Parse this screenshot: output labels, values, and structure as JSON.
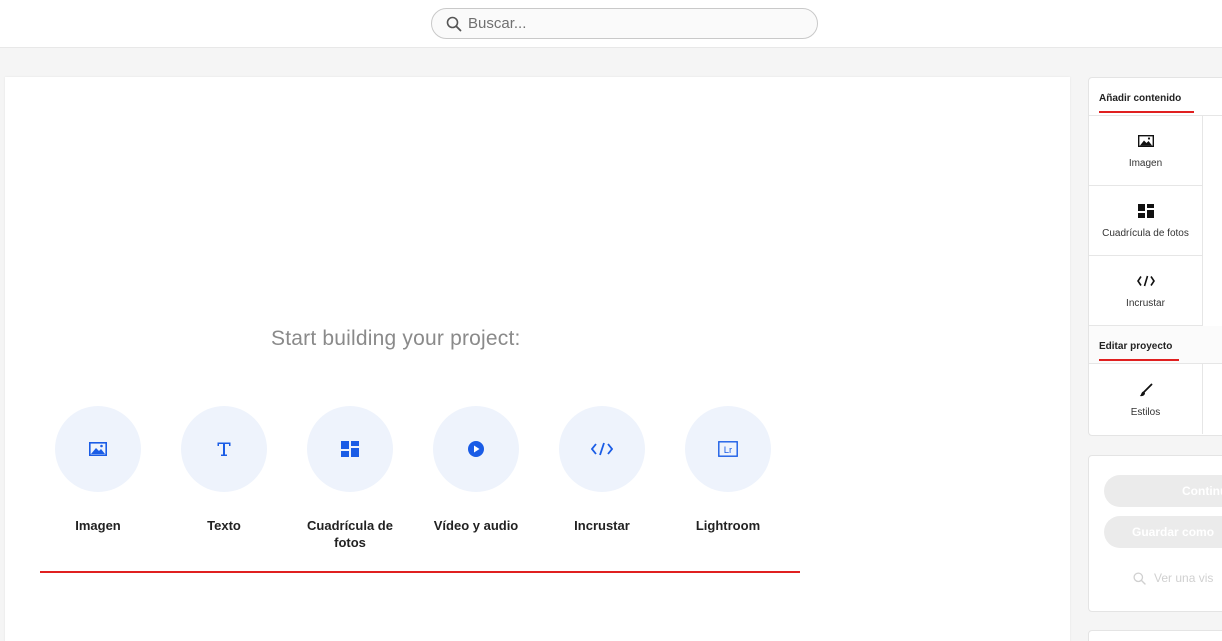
{
  "search": {
    "placeholder": "Buscar..."
  },
  "canvas": {
    "title": "Start building your project:",
    "tiles": [
      {
        "label": "Imagen",
        "icon": "image-icon"
      },
      {
        "label": "Texto",
        "icon": "text-icon"
      },
      {
        "label": "Cuadrícula de fotos",
        "icon": "photo-grid-icon"
      },
      {
        "label": "Vídeo y audio",
        "icon": "play-icon"
      },
      {
        "label": "Incrustar",
        "icon": "embed-code-icon"
      },
      {
        "label": "Lightroom",
        "icon": "lightroom-icon"
      }
    ]
  },
  "panel": {
    "add_content_title": "Añadir contenido",
    "add_items": [
      {
        "label": "Imagen",
        "icon": "image-icon"
      },
      {
        "label": "Cuadrícula de fotos",
        "icon": "photo-grid-icon"
      },
      {
        "label": "Incrustar",
        "icon": "embed-code-icon"
      }
    ],
    "edit_project_title": "Editar proyecto",
    "edit_items": [
      {
        "label": "Estilos",
        "icon": "brush-icon"
      }
    ]
  },
  "actions": {
    "continue_label": "Continu",
    "save_label": "Guardar como",
    "preview_label": "Ver una vis"
  },
  "colors": {
    "accent_blue": "#1a5ce6",
    "tile_bg": "#eef3fc",
    "red_underline": "#e02020"
  }
}
